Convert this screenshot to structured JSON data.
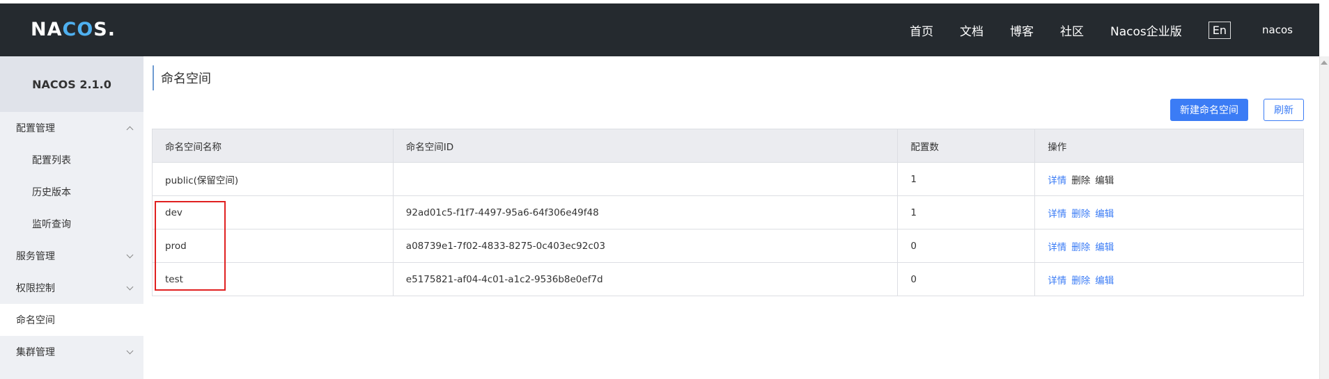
{
  "header": {
    "logo_prefix": "NA",
    "logo_oo": "CO",
    "logo_suffix": "S.",
    "nav": [
      "首页",
      "文档",
      "博客",
      "社区",
      "Nacos企业版"
    ],
    "lang": "En",
    "user": "nacos"
  },
  "sidebar": {
    "version": "NACOS 2.1.0",
    "items": [
      {
        "label": "配置管理",
        "level": 1,
        "chevron": "up"
      },
      {
        "label": "配置列表",
        "level": 2
      },
      {
        "label": "历史版本",
        "level": 2
      },
      {
        "label": "监听查询",
        "level": 2
      },
      {
        "label": "服务管理",
        "level": 1,
        "chevron": "down"
      },
      {
        "label": "权限控制",
        "level": 1,
        "chevron": "down"
      },
      {
        "label": "命名空间",
        "level": 1,
        "active": true
      },
      {
        "label": "集群管理",
        "level": 1,
        "chevron": "down"
      }
    ]
  },
  "main": {
    "title": "命名空间",
    "new_button": "新建命名空间",
    "refresh_button": "刷新",
    "table": {
      "headers": [
        "命名空间名称",
        "命名空间ID",
        "配置数",
        "操作"
      ],
      "rows": [
        {
          "name": "public(保留空间)",
          "id": "",
          "count": "1",
          "ops": [
            "详情",
            "删除",
            "编辑"
          ],
          "ops_style": [
            "blue",
            "dark",
            "dark"
          ]
        },
        {
          "name": "dev",
          "id": "92ad01c5-f1f7-4497-95a6-64f306e49f48",
          "count": "1",
          "ops": [
            "详情",
            "删除",
            "编辑"
          ],
          "ops_style": [
            "blue",
            "blue",
            "blue"
          ]
        },
        {
          "name": "prod",
          "id": "a08739e1-7f02-4833-8275-0c403ec92c03",
          "count": "0",
          "ops": [
            "详情",
            "删除",
            "编辑"
          ],
          "ops_style": [
            "blue",
            "blue",
            "blue"
          ]
        },
        {
          "name": "test",
          "id": "e5175821-af04-4c01-a1c2-9536b8e0ef7d",
          "count": "0",
          "ops": [
            "详情",
            "删除",
            "编辑"
          ],
          "ops_style": [
            "blue",
            "blue",
            "blue"
          ]
        }
      ]
    }
  },
  "colors": {
    "header_bg": "#252a2f",
    "primary": "#3b7cf5",
    "highlight": "#e02020"
  }
}
